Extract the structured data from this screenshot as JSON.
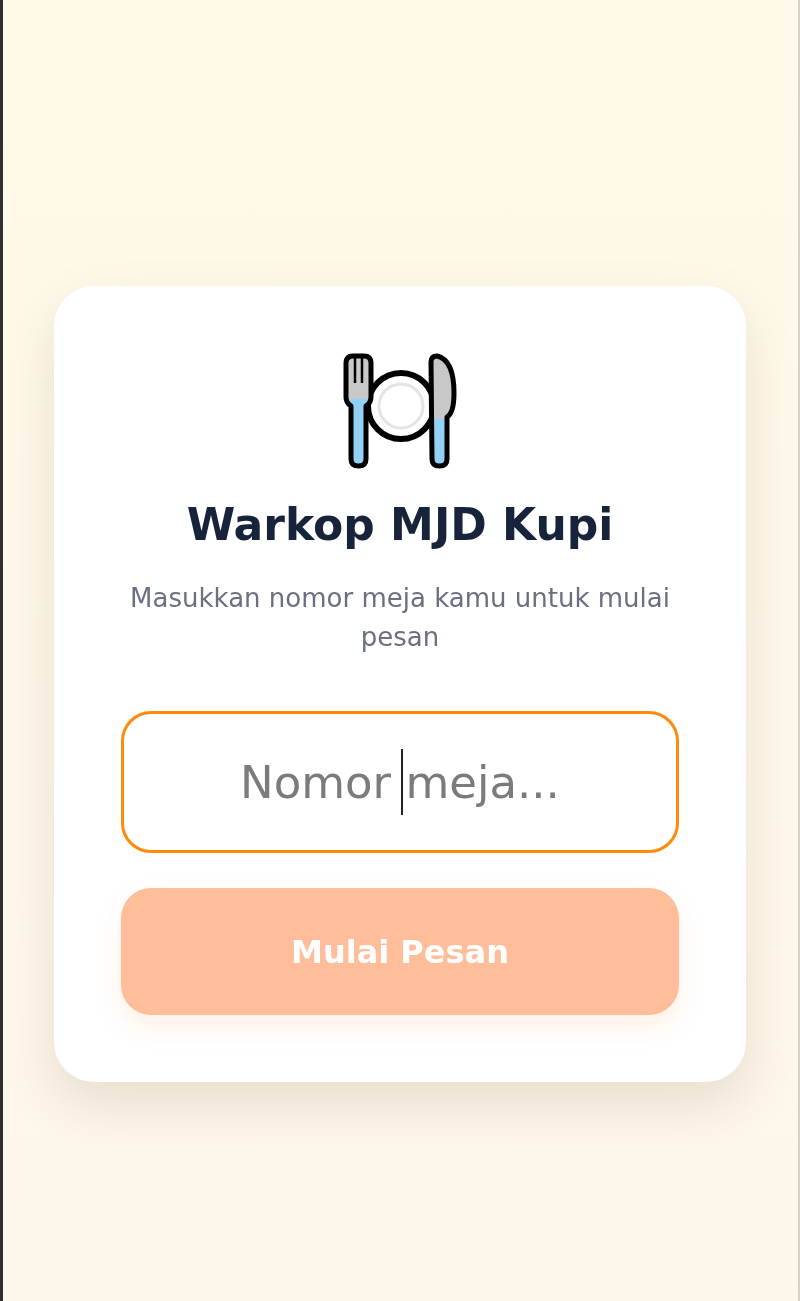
{
  "brand": {
    "title": "Warkop MJD Kupi",
    "subtitle": "Masukkan nomor meja kamu untuk mulai pesan"
  },
  "table_field": {
    "placeholder": "Nomor meja...",
    "focused": true
  },
  "start_button": {
    "label": "Mulai Pesan",
    "disabled": true
  }
}
